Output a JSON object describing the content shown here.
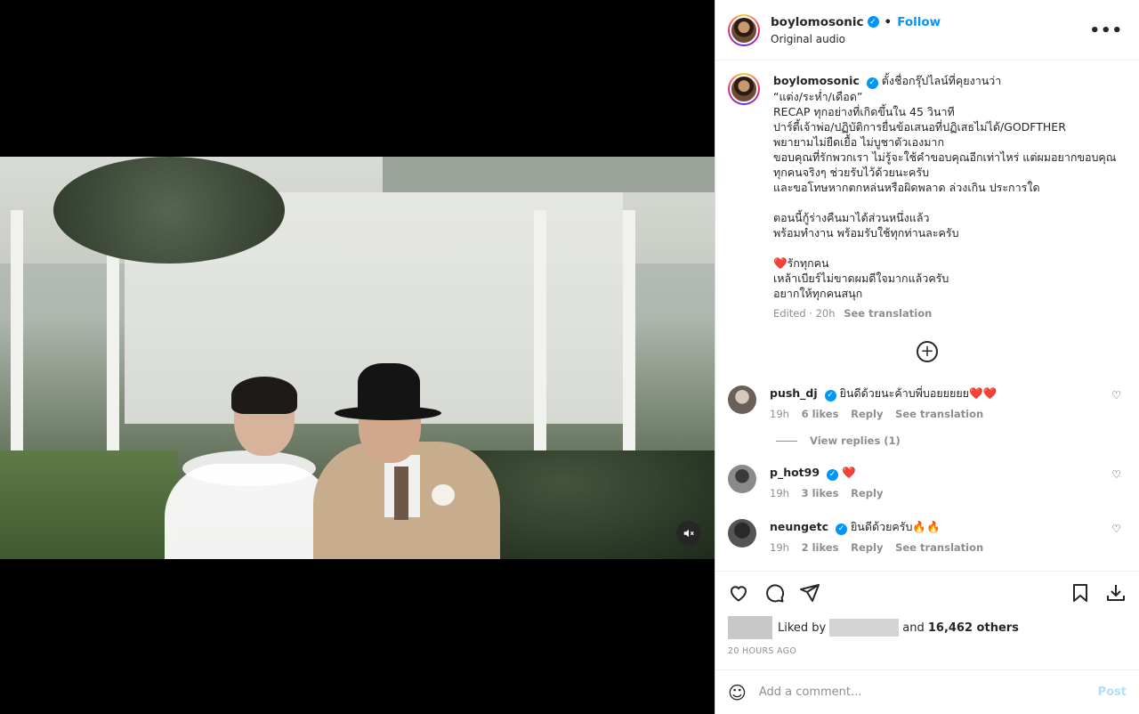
{
  "post": {
    "username": "boylomosonic",
    "follow_label": "Follow",
    "subtitle": "Original audio",
    "more": "•••",
    "caption_lines": [
      "ตั้งชื่อกรุ๊ปไลน์ที่คุยงานว่า",
      "“แต่ง/ระห่ำ/เดือด”",
      "RECAP ทุกอย่างที่เกิดขึ้นใน 45 วินาที",
      "ปาร์ตี้เจ้าพ่อ/ปฏิบัติการยื่นข้อเสนอที่ปฏิเสธไม่ได้/GODFTHER",
      "พยายามไม่ยืดเยื้อ ไม่บูชาตัวเองมาก",
      "ขอบคุณที่รักพวกเรา ไม่รู้จะใช้คำขอบคุณอีกเท่าไหร่ แต่ผมอยากขอบคุณ",
      "ทุกคนจริงๆ ช่วยรับไว้ด้วยนะครับ",
      "และขอโทษหากตกหล่นหรือผิดพลาด ล่วงเกิน ประการใด"
    ],
    "caption_lines_2": [
      "ตอนนี้กู้ร่างคืนมาได้ส่วนหนึ่งแล้ว",
      "พร้อมทำงาน พร้อมรับใช้ทุกท่านละครับ"
    ],
    "caption_lines_3": [
      "❤️รักทุกคน",
      "เหล้าเบียร์ไม่ขาดผมดีใจมากแล้วครับ",
      "อยากให้ทุกคนสนุก"
    ],
    "edited": "Edited · 20h",
    "see_translation": "See translation"
  },
  "comments": [
    {
      "user": "push_dj",
      "text": "ยินดีด้วยนะค้าบพี่บอยยยยย❤️❤️",
      "time": "19h",
      "likes": "6 likes",
      "reply": "Reply",
      "translate": "See translation"
    },
    {
      "user": "p_hot99",
      "text": "❤️",
      "time": "19h",
      "likes": "3 likes",
      "reply": "Reply",
      "translate": ""
    },
    {
      "user": "neungetc",
      "text": "ยินดีด้วยครับ🔥🔥",
      "time": "19h",
      "likes": "2 likes",
      "reply": "Reply",
      "translate": "See translation"
    }
  ],
  "view_replies": "View replies (1)",
  "likes": {
    "prefix": "Liked by",
    "and": "and",
    "count": "16,462 others"
  },
  "timestamp": "20 HOURS AGO",
  "add_comment": {
    "placeholder": "Add a comment...",
    "post_label": "Post"
  },
  "icons": [
    "heart-icon",
    "comment-icon",
    "share-icon",
    "bookmark-icon",
    "download-icon",
    "emoji-icon",
    "mute-icon",
    "plus-icon"
  ]
}
